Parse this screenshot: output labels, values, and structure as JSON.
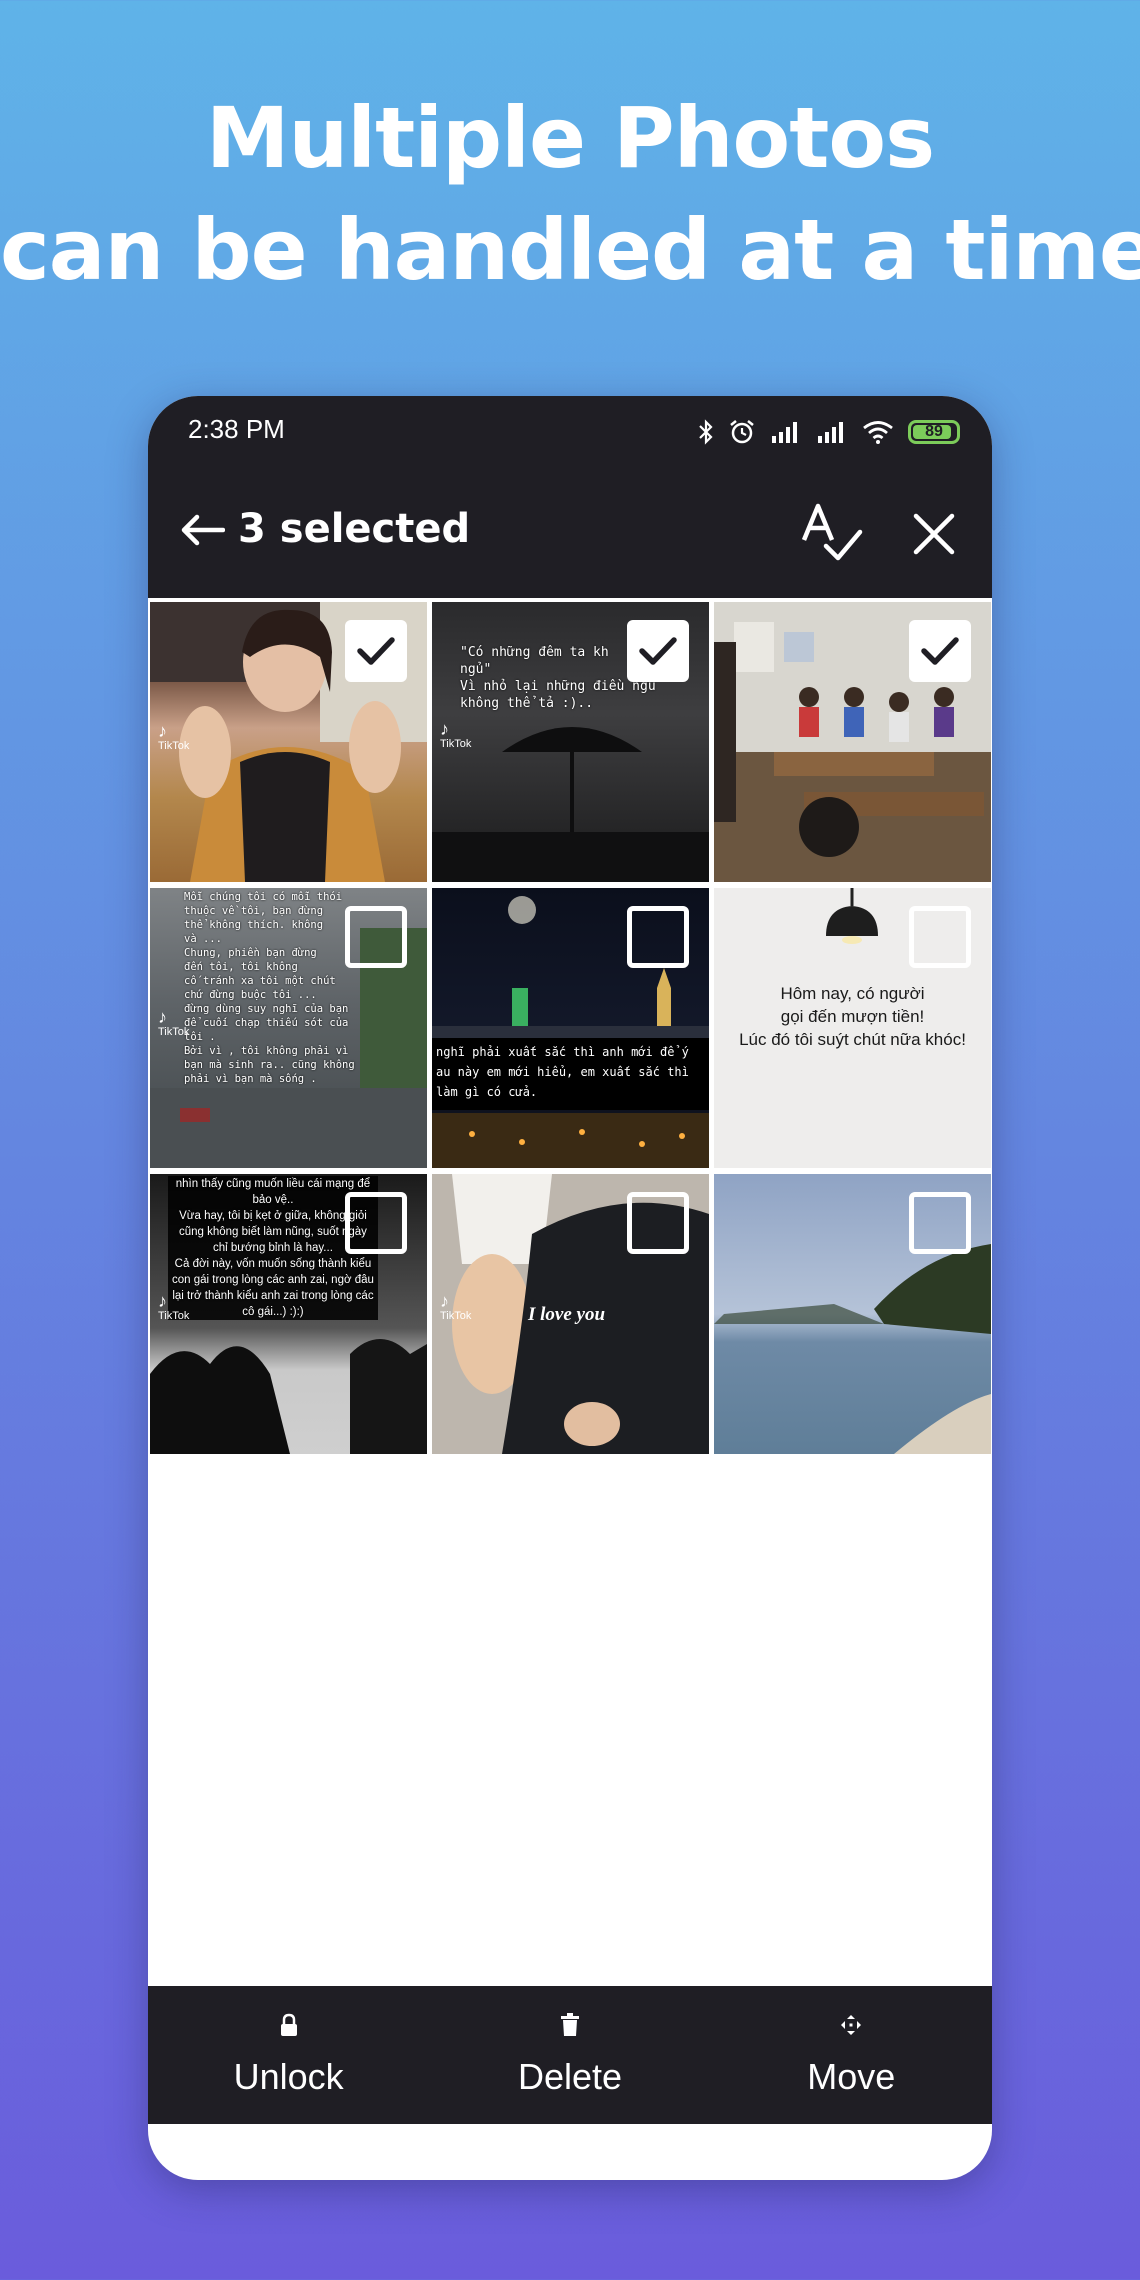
{
  "headline": {
    "line1": "Multiple Photos",
    "line2": "can be handled at a time"
  },
  "status_bar": {
    "time": "2:38 PM",
    "battery": "89",
    "icons": [
      "bluetooth-icon",
      "alarm-icon",
      "signal-icon",
      "signal-icon",
      "wifi-icon",
      "battery-icon"
    ]
  },
  "app_bar": {
    "title": "3 selected",
    "icons": [
      "back-arrow-icon",
      "spellcheck-select-all-icon",
      "close-icon"
    ]
  },
  "photos": [
    {
      "selected": true,
      "tiktok": "TikTok",
      "caption": ""
    },
    {
      "selected": true,
      "tiktok": "TikTok",
      "caption": "\"Có những đêm ta kh\nngủ\"\nVì nhỏ lại những điều ngu\nkhông thể tả :).."
    },
    {
      "selected": true,
      "tiktok": "",
      "caption": ""
    },
    {
      "selected": false,
      "tiktok": "TikTok",
      "caption": "Mỗi chúng tôi có mỗi thói\nthuộc về tôi, bạn đừng\nthể không thích. không\nvà ...\nChung, phiền bạn đừng\nđến tôi, tôi không\ncố tránh xa tôi một chút\nchứ đừng buộc tôi ...\nđừng dùng suy nghĩ của bạn\nđể cuối chạp thiếu sót của\ntôi .\nBởi vì , tôi không phải vì\nbạn mà sinh ra.. cũng không\nphải vì bạn mà sống ."
    },
    {
      "selected": false,
      "tiktok": "",
      "caption": "nghĩ phải xuất sắc thì anh mới để ý\nau này em mới hiểu, em xuất sắc thì\nlàm gì có cửa."
    },
    {
      "selected": false,
      "tiktok": "",
      "caption": "Hôm nay, có người\ngọi đến mượn tiền!\nLúc đó tôi suýt chút nữa khóc!"
    },
    {
      "selected": false,
      "tiktok": "TikTok",
      "caption": "nhìn thấy cũng muốn liều cái mạng để\nbảo vệ..\nVừa hay, tôi bị kẹt ở giữa, không giỏi\ncũng không biết làm nũng, suốt ngày\nchỉ bướng bỉnh là hay...\nCả đời này, vốn muốn sống thành kiểu\ncon gái trong lòng các anh zai, ngờ đâu\nlại trở thành kiểu anh zai trong lòng các\ncô gái...) :):)"
    },
    {
      "selected": false,
      "tiktok": "TikTok",
      "caption": "I love you"
    },
    {
      "selected": false,
      "tiktok": "",
      "caption": ""
    }
  ],
  "bottom_actions": [
    {
      "label": "Unlock",
      "icon": "lock-icon"
    },
    {
      "label": "Delete",
      "icon": "trash-icon"
    },
    {
      "label": "Move",
      "icon": "move-icon"
    }
  ]
}
